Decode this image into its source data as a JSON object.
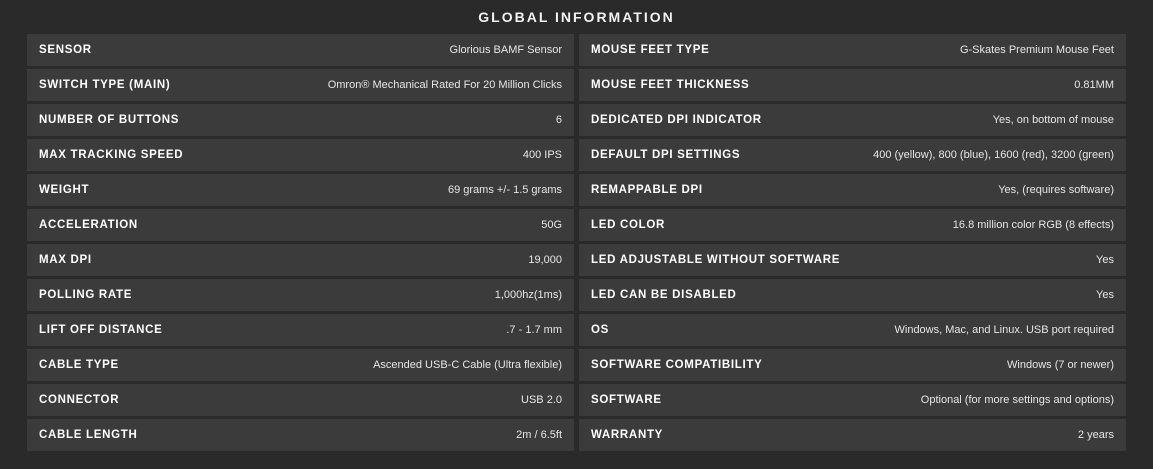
{
  "title": "GLOBAL INFORMATION",
  "left": [
    {
      "label": "SENSOR",
      "value": "Glorious BAMF Sensor"
    },
    {
      "label": "SWITCH TYPE (MAIN)",
      "value": "Omron® Mechanical Rated For 20 Million Clicks"
    },
    {
      "label": "NUMBER OF BUTTONS",
      "value": "6"
    },
    {
      "label": "MAX TRACKING SPEED",
      "value": "400 IPS"
    },
    {
      "label": "WEIGHT",
      "value": "69 grams +/- 1.5 grams"
    },
    {
      "label": "ACCELERATION",
      "value": "50G"
    },
    {
      "label": "MAX DPI",
      "value": "19,000"
    },
    {
      "label": "POLLING RATE",
      "value": "1,000hz(1ms)"
    },
    {
      "label": "LIFT OFF DISTANCE",
      "value": ".7 - 1.7 mm"
    },
    {
      "label": "CABLE TYPE",
      "value": "Ascended USB-C Cable (Ultra flexible)"
    },
    {
      "label": "CONNECTOR",
      "value": "USB 2.0"
    },
    {
      "label": "CABLE LENGTH",
      "value": "2m / 6.5ft"
    }
  ],
  "right": [
    {
      "label": "MOUSE FEET TYPE",
      "value": "G-Skates Premium Mouse Feet"
    },
    {
      "label": "MOUSE FEET THICKNESS",
      "value": "0.81MM"
    },
    {
      "label": "DEDICATED DPI INDICATOR",
      "value": "Yes, on bottom of mouse"
    },
    {
      "label": "DEFAULT DPI SETTINGS",
      "value": "400 (yellow), 800 (blue), 1600 (red), 3200 (green)"
    },
    {
      "label": "REMAPPABLE DPI",
      "value": "Yes, (requires software)"
    },
    {
      "label": "LED COLOR",
      "value": "16.8 million color RGB (8 effects)"
    },
    {
      "label": "LED ADJUSTABLE WITHOUT SOFTWARE",
      "value": "Yes"
    },
    {
      "label": "LED CAN BE DISABLED",
      "value": "Yes"
    },
    {
      "label": "OS",
      "value": "Windows, Mac, and Linux. USB port required"
    },
    {
      "label": "SOFTWARE COMPATIBILITY",
      "value": "Windows (7 or newer)"
    },
    {
      "label": "SOFTWARE",
      "value": "Optional (for more settings and options)"
    },
    {
      "label": "WARRANTY",
      "value": "2 years"
    }
  ],
  "colors": {
    "background": "#2a2a2a",
    "row_background": "#3b3b3b",
    "text": "#ffffff"
  }
}
